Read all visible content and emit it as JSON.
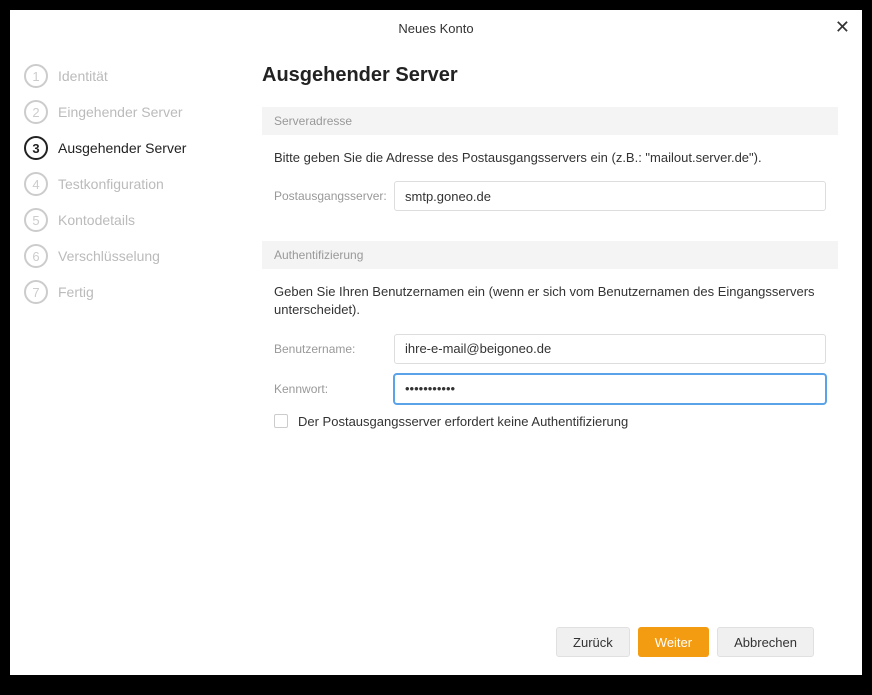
{
  "titlebar": {
    "title": "Neues Konto"
  },
  "sidebar": {
    "steps": [
      {
        "num": "1",
        "label": "Identität"
      },
      {
        "num": "2",
        "label": "Eingehender Server"
      },
      {
        "num": "3",
        "label": "Ausgehender Server"
      },
      {
        "num": "4",
        "label": "Testkonfiguration"
      },
      {
        "num": "5",
        "label": "Kontodetails"
      },
      {
        "num": "6",
        "label": "Verschlüsselung"
      },
      {
        "num": "7",
        "label": "Fertig"
      }
    ]
  },
  "main": {
    "title": "Ausgehender Server",
    "section1": {
      "header": "Serveradresse",
      "helper": "Bitte geben Sie die Adresse des Postausgangsservers ein (z.B.: \"mailout.server.de\").",
      "field_label": "Postausgangsserver:",
      "field_value": "smtp.goneo.de"
    },
    "section2": {
      "header": "Authentifizierung",
      "helper": "Geben Sie Ihren Benutzernamen ein (wenn er sich vom Benutzernamen des Eingangsservers unterscheidet).",
      "user_label": "Benutzername:",
      "user_value": "ihre-e-mail@beigoneo.de",
      "pass_label": "Kennwort:",
      "pass_value": "•••••••••••",
      "checkbox_label": "Der Postausgangsserver erfordert keine Authentifizierung"
    }
  },
  "footer": {
    "back": "Zurück",
    "next": "Weiter",
    "cancel": "Abbrechen"
  }
}
